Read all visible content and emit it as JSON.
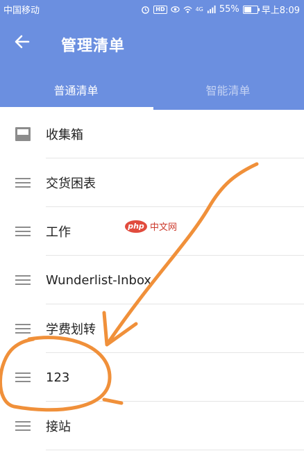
{
  "status_bar": {
    "carrier": "中国移动",
    "hd": "HD",
    "signal": "4G",
    "battery": "55%",
    "battery_level": 0.55,
    "time": "早上8:09"
  },
  "appbar": {
    "title": "管理清单"
  },
  "tabs": [
    {
      "label": "普通清单",
      "active": true
    },
    {
      "label": "智能清单",
      "active": false
    }
  ],
  "list": {
    "items": [
      {
        "label": "收集箱",
        "icon": "inbox-icon"
      },
      {
        "label": "交货困表",
        "icon": "drag-handle-icon"
      },
      {
        "label": "工作",
        "icon": "drag-handle-icon"
      },
      {
        "label": "Wunderlist-Inbox",
        "icon": "drag-handle-icon"
      },
      {
        "label": "学费划转",
        "icon": "drag-handle-icon"
      },
      {
        "label": "123",
        "icon": "drag-handle-icon"
      },
      {
        "label": "接站",
        "icon": "drag-handle-icon"
      }
    ]
  },
  "watermark": {
    "logo": "php",
    "text": "中文网"
  },
  "colors": {
    "primary": "#6b8fe0",
    "annotation": "#f0903a",
    "icon_gray": "#8c8c8c"
  }
}
